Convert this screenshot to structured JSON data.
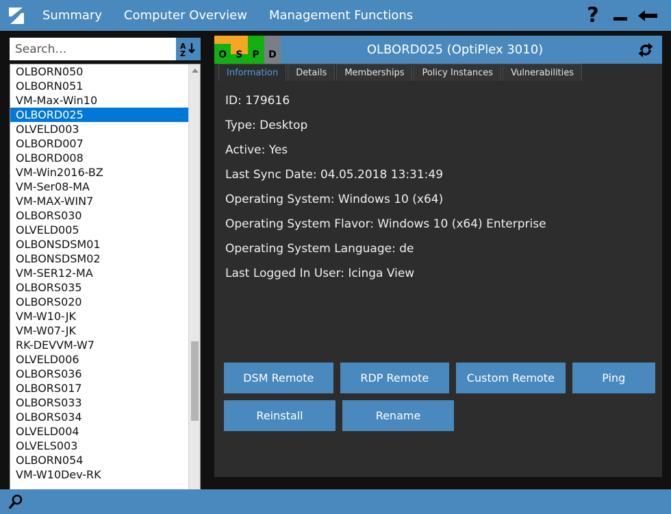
{
  "window": {
    "menu": [
      {
        "label": "Summary",
        "name": "menu-summary"
      },
      {
        "label": "Computer Overview",
        "name": "menu-computer-overview"
      },
      {
        "label": "Management Functions",
        "name": "menu-management-functions"
      }
    ],
    "controls": {
      "help": "?",
      "minimize": "—",
      "back": "←"
    },
    "logo_name": "app-logo-icon"
  },
  "sidebar": {
    "search": {
      "value": "",
      "placeholder": "Search…"
    },
    "sort_button": {
      "top_letter": "A",
      "bottom_letter": "Z",
      "arrow": "↓"
    },
    "selected": "OLBORD025",
    "items": [
      "OLBORN050",
      "OLBORN051",
      "VM-Max-Win10",
      "OLBORD025",
      "OLVELD003",
      "OLBORD007",
      "OLBORD008",
      "VM-Win2016-BZ",
      "VM-Ser08-MA",
      "VM-MAX-WIN7",
      "OLBORS030",
      "OLVELD005",
      "OLBONSDSM01",
      "OLBONSDSM02",
      "VM-SER12-MA",
      "OLBORS035",
      "OLBORS020",
      "VM-W10-JK",
      "VM-W07-JK",
      "RK-DEVVM-W7",
      "OLVELD006",
      "OLBORS036",
      "OLBORS017",
      "OLBORS033",
      "OLBORS034",
      "OLVELD004",
      "OLVELS003",
      "OLBORN054",
      "VM-W10Dev-RK"
    ]
  },
  "panel": {
    "title": "OLBORD025 (OptiPlex 3010)",
    "refresh_icon": "refresh-icon",
    "status_indicators": [
      {
        "letter": "O",
        "top_color": "#f5a623",
        "bottom_color": "#12b112",
        "top_pct": 30
      },
      {
        "letter": "S",
        "top_color": "#f5a623",
        "bottom_color": "#12b112",
        "top_pct": 66
      },
      {
        "letter": "P",
        "top_color": "#12b112",
        "bottom_color": "#12b112",
        "top_pct": 100
      },
      {
        "letter": "D",
        "top_color": "#7a7f85",
        "bottom_color": "#7a7f85",
        "top_pct": 100
      }
    ],
    "tabs": [
      {
        "label": "Information",
        "active": true
      },
      {
        "label": "Details",
        "active": false
      },
      {
        "label": "Memberships",
        "active": false
      },
      {
        "label": "Policy Instances",
        "active": false
      },
      {
        "label": "Vulnerabilities",
        "active": false
      }
    ],
    "info": [
      "ID: 179616",
      "Type: Desktop",
      "Active: Yes",
      "Last Sync Date: 04.05.2018 13:31:49",
      "Operating System: Windows 10 (x64)",
      "Operating System Flavor: Windows 10 (x64) Enterprise",
      "Operating System Language: de",
      "Last Logged In User: Icinga View"
    ],
    "actions": {
      "dsm_remote": "DSM Remote",
      "rdp_remote": "RDP Remote",
      "custom_remote": "Custom Remote",
      "ping": "Ping",
      "reinstall": "Reinstall",
      "rename": "Rename"
    }
  },
  "statusbar": {
    "search_icon": "search-icon",
    "text": ""
  },
  "colors": {
    "accent": "#4a89bd",
    "selection": "#0078d7",
    "panel_bg": "#2d2d2d",
    "app_bg": "#111111",
    "status_ok": "#12b112",
    "status_warn": "#f5a623",
    "status_none": "#7a7f85",
    "tab_active_text": "#4a9fe0"
  }
}
